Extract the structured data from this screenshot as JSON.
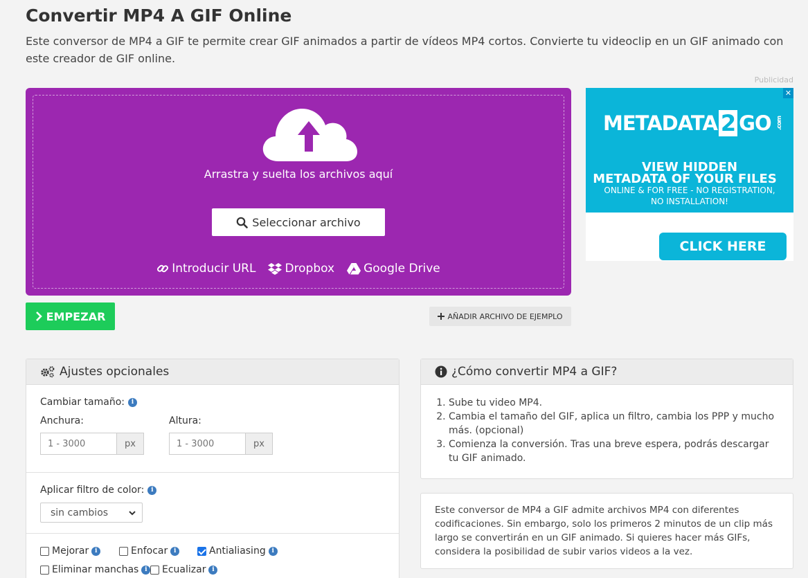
{
  "page": {
    "title": "Convertir MP4 A GIF Online",
    "description": "Este conversor de MP4 a GIF te permite crear GIF animados a partir de vídeos MP4 cortos. Convierte tu videoclip en un GIF animado con este creador de GIF online."
  },
  "upload": {
    "drop_text": "Arrastra y suelta los archivos aquí",
    "select_label": "Seleccionar archivo",
    "url_label": "Introducir URL",
    "dropbox_label": "Dropbox",
    "gdrive_label": "Google Drive"
  },
  "actions": {
    "start_label": "EMPEZAR",
    "example_label": "AÑADIR ARCHIVO DE EJEMPLO"
  },
  "ad": {
    "label": "Publicidad",
    "brand_a": "METADATA",
    "brand_b": "2",
    "brand_c": "GO",
    "brand_com": ".com",
    "headline_1": "VIEW HIDDEN",
    "headline_2": "METADATA OF YOUR FILES",
    "sub_1": "ONLINE & FOR FREE - NO REGISTRATION,",
    "sub_2": "NO INSTALLATION!",
    "cta": "CLICK HERE"
  },
  "settings": {
    "title": "Ajustes opcionales",
    "resize_label": "Cambiar tamaño:",
    "width_label": "Anchura:",
    "height_label": "Altura:",
    "width_placeholder": "1 - 3000",
    "height_placeholder": "1 - 3000",
    "unit": "px",
    "filter_label": "Aplicar filtro de color:",
    "filter_value": "sin cambios",
    "options": [
      {
        "label": "Mejorar",
        "checked": false
      },
      {
        "label": "Enfocar",
        "checked": false
      },
      {
        "label": "Antialiasing",
        "checked": true
      },
      {
        "label": "Eliminar manchas",
        "checked": false
      },
      {
        "label": "Ecualizar",
        "checked": false
      }
    ]
  },
  "howto": {
    "title": "¿Cómo convertir MP4 a GIF?",
    "steps": [
      "Sube tu video MP4.",
      "Cambia el tamaño del GIF, aplica un filtro, cambia los PPP y mucho más. (opcional)",
      "Comienza la conversión. Tras una breve espera, podrás descargar tu GIF animado."
    ]
  },
  "info": {
    "text": "Este conversor de MP4 a GIF admite archivos MP4 con diferentes codificaciones. Sin embargo, solo los primeros 2 minutos de un clip más largo se convertirán en un GIF animado. Si quieres hacer más GIFs, considera la posibilidad de subir varios videos a la vez."
  },
  "colors": {
    "dropzone": "#9c27b0",
    "start": "#1dcc5a",
    "ad": "#0bb5d9"
  }
}
